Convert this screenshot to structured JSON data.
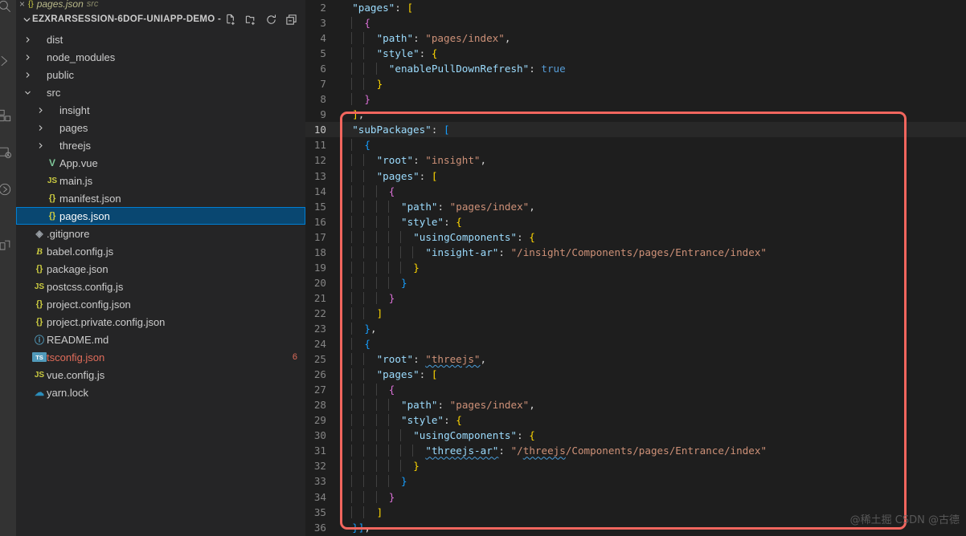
{
  "activity_bar": {
    "icons": [
      "search-icon",
      "source-control-icon",
      "extensions-icon",
      "debug-icon",
      "remote-icon",
      "testing-icon"
    ]
  },
  "tab": {
    "label": "pages.json",
    "sublabel": "src",
    "close": "×",
    "icon": "json-icon"
  },
  "sidebar": {
    "title": "EZXRARSESSION-6DOF-UNIAPP-DEMO - ...",
    "actions": [
      {
        "name": "new-file-icon",
        "tooltip": "New File"
      },
      {
        "name": "new-folder-icon",
        "tooltip": "New Folder"
      },
      {
        "name": "refresh-icon",
        "tooltip": "Refresh Explorer"
      },
      {
        "name": "collapse-all-icon",
        "tooltip": "Collapse Folders in Explorer"
      }
    ],
    "tree": [
      {
        "label": "dist",
        "type": "folder",
        "indent": 1,
        "expanded": false
      },
      {
        "label": "node_modules",
        "type": "folder",
        "indent": 1,
        "expanded": false
      },
      {
        "label": "public",
        "type": "folder",
        "indent": 1,
        "expanded": false
      },
      {
        "label": "src",
        "type": "folder",
        "indent": 1,
        "expanded": true
      },
      {
        "label": "insight",
        "type": "folder",
        "indent": 2,
        "expanded": false
      },
      {
        "label": "pages",
        "type": "folder",
        "indent": 2,
        "expanded": false
      },
      {
        "label": "threejs",
        "type": "folder",
        "indent": 2,
        "expanded": false
      },
      {
        "label": "App.vue",
        "type": "vue",
        "indent": 2,
        "icon_glyph": "V"
      },
      {
        "label": "main.js",
        "type": "js",
        "indent": 2,
        "icon_glyph": "JS"
      },
      {
        "label": "manifest.json",
        "type": "json",
        "indent": 2,
        "icon_glyph": "{}"
      },
      {
        "label": "pages.json",
        "type": "json",
        "indent": 2,
        "icon_glyph": "{}",
        "selected": true
      },
      {
        "label": ".gitignore",
        "type": "git",
        "indent": 1,
        "icon_glyph": "◈"
      },
      {
        "label": "babel.config.js",
        "type": "babel",
        "indent": 1,
        "icon_glyph": "B"
      },
      {
        "label": "package.json",
        "type": "json",
        "indent": 1,
        "icon_glyph": "{}"
      },
      {
        "label": "postcss.config.js",
        "type": "js",
        "indent": 1,
        "icon_glyph": "JS"
      },
      {
        "label": "project.config.json",
        "type": "json",
        "indent": 1,
        "icon_glyph": "{}"
      },
      {
        "label": "project.private.config.json",
        "type": "json",
        "indent": 1,
        "icon_glyph": "{}"
      },
      {
        "label": "README.md",
        "type": "md",
        "indent": 1,
        "icon_glyph": "ⓘ"
      },
      {
        "label": "tsconfig.json",
        "type": "ts",
        "indent": 1,
        "icon_glyph": "TS",
        "error": true,
        "badge": "6"
      },
      {
        "label": "vue.config.js",
        "type": "js",
        "indent": 1,
        "icon_glyph": "JS"
      },
      {
        "label": "yarn.lock",
        "type": "yarn",
        "indent": 1,
        "icon_glyph": "☁"
      }
    ]
  },
  "editor": {
    "language": "json",
    "first_visible_line": 2,
    "current_line": 10,
    "lines": [
      {
        "n": 2,
        "indent": 1,
        "tokens": [
          {
            "t": "\"pages\"",
            "c": "k"
          },
          {
            "t": ": ",
            "c": "p"
          },
          {
            "t": "[",
            "c": "b0"
          }
        ]
      },
      {
        "n": 3,
        "indent": 2,
        "tokens": [
          {
            "t": "{",
            "c": "b1"
          }
        ]
      },
      {
        "n": 4,
        "indent": 3,
        "tokens": [
          {
            "t": "\"path\"",
            "c": "k"
          },
          {
            "t": ": ",
            "c": "p"
          },
          {
            "t": "\"pages/index\"",
            "c": "s"
          },
          {
            "t": ",",
            "c": "p"
          }
        ]
      },
      {
        "n": 5,
        "indent": 3,
        "tokens": [
          {
            "t": "\"style\"",
            "c": "k"
          },
          {
            "t": ": ",
            "c": "p"
          },
          {
            "t": "{",
            "c": "b0"
          }
        ]
      },
      {
        "n": 6,
        "indent": 4,
        "tokens": [
          {
            "t": "\"enablePullDownRefresh\"",
            "c": "k"
          },
          {
            "t": ": ",
            "c": "p"
          },
          {
            "t": "true",
            "c": "bool"
          }
        ]
      },
      {
        "n": 7,
        "indent": 3,
        "tokens": [
          {
            "t": "}",
            "c": "b0"
          }
        ]
      },
      {
        "n": 8,
        "indent": 2,
        "tokens": [
          {
            "t": "}",
            "c": "b1"
          }
        ]
      },
      {
        "n": 9,
        "indent": 1,
        "tokens": [
          {
            "t": "]",
            "c": "b0"
          },
          {
            "t": ",",
            "c": "p"
          }
        ]
      },
      {
        "n": 10,
        "indent": 1,
        "tokens": [
          {
            "t": "\"subPackages\"",
            "c": "k"
          },
          {
            "t": ": ",
            "c": "p"
          },
          {
            "t": "[",
            "c": "b2"
          }
        ],
        "current": true
      },
      {
        "n": 11,
        "indent": 2,
        "tokens": [
          {
            "t": "{",
            "c": "b2"
          }
        ]
      },
      {
        "n": 12,
        "indent": 3,
        "tokens": [
          {
            "t": "\"root\"",
            "c": "k"
          },
          {
            "t": ": ",
            "c": "p"
          },
          {
            "t": "\"insight\"",
            "c": "s"
          },
          {
            "t": ",",
            "c": "p"
          }
        ]
      },
      {
        "n": 13,
        "indent": 3,
        "tokens": [
          {
            "t": "\"pages\"",
            "c": "k"
          },
          {
            "t": ": ",
            "c": "p"
          },
          {
            "t": "[",
            "c": "b0"
          }
        ]
      },
      {
        "n": 14,
        "indent": 4,
        "tokens": [
          {
            "t": "{",
            "c": "b1"
          }
        ]
      },
      {
        "n": 15,
        "indent": 5,
        "tokens": [
          {
            "t": "\"path\"",
            "c": "k"
          },
          {
            "t": ": ",
            "c": "p"
          },
          {
            "t": "\"pages/index\"",
            "c": "s"
          },
          {
            "t": ",",
            "c": "p"
          }
        ]
      },
      {
        "n": 16,
        "indent": 5,
        "tokens": [
          {
            "t": "\"style\"",
            "c": "k"
          },
          {
            "t": ": ",
            "c": "p"
          },
          {
            "t": "{",
            "c": "b0"
          }
        ]
      },
      {
        "n": 17,
        "indent": 6,
        "tokens": [
          {
            "t": "\"usingComponents\"",
            "c": "k"
          },
          {
            "t": ": ",
            "c": "p"
          },
          {
            "t": "{",
            "c": "b0"
          }
        ]
      },
      {
        "n": 18,
        "indent": 7,
        "tokens": [
          {
            "t": "\"insight-ar\"",
            "c": "k"
          },
          {
            "t": ": ",
            "c": "p"
          },
          {
            "t": "\"/insight/Components/pages/Entrance/index\"",
            "c": "s"
          }
        ]
      },
      {
        "n": 19,
        "indent": 6,
        "tokens": [
          {
            "t": "}",
            "c": "b0"
          }
        ]
      },
      {
        "n": 20,
        "indent": 5,
        "tokens": [
          {
            "t": "}",
            "c": "b2"
          }
        ]
      },
      {
        "n": 21,
        "indent": 4,
        "tokens": [
          {
            "t": "}",
            "c": "b1"
          }
        ]
      },
      {
        "n": 22,
        "indent": 3,
        "tokens": [
          {
            "t": "]",
            "c": "b0"
          }
        ]
      },
      {
        "n": 23,
        "indent": 2,
        "tokens": [
          {
            "t": "}",
            "c": "b2"
          },
          {
            "t": ",",
            "c": "p"
          }
        ]
      },
      {
        "n": 24,
        "indent": 2,
        "tokens": [
          {
            "t": "{",
            "c": "b2"
          }
        ]
      },
      {
        "n": 25,
        "indent": 3,
        "tokens": [
          {
            "t": "\"root\"",
            "c": "k"
          },
          {
            "t": ": ",
            "c": "p"
          },
          {
            "t": "\"threejs\"",
            "c": "s",
            "sq": true
          },
          {
            "t": ",",
            "c": "p"
          }
        ]
      },
      {
        "n": 26,
        "indent": 3,
        "tokens": [
          {
            "t": "\"pages\"",
            "c": "k"
          },
          {
            "t": ": ",
            "c": "p"
          },
          {
            "t": "[",
            "c": "b0"
          }
        ]
      },
      {
        "n": 27,
        "indent": 4,
        "tokens": [
          {
            "t": "{",
            "c": "b1"
          }
        ]
      },
      {
        "n": 28,
        "indent": 5,
        "tokens": [
          {
            "t": "\"path\"",
            "c": "k"
          },
          {
            "t": ": ",
            "c": "p"
          },
          {
            "t": "\"pages/index\"",
            "c": "s"
          },
          {
            "t": ",",
            "c": "p"
          }
        ]
      },
      {
        "n": 29,
        "indent": 5,
        "tokens": [
          {
            "t": "\"style\"",
            "c": "k"
          },
          {
            "t": ": ",
            "c": "p"
          },
          {
            "t": "{",
            "c": "b0"
          }
        ]
      },
      {
        "n": 30,
        "indent": 6,
        "tokens": [
          {
            "t": "\"usingComponents\"",
            "c": "k"
          },
          {
            "t": ": ",
            "c": "p"
          },
          {
            "t": "{",
            "c": "b0"
          }
        ]
      },
      {
        "n": 31,
        "indent": 7,
        "tokens": [
          {
            "t": "\"threejs-ar\"",
            "c": "k",
            "sq": true
          },
          {
            "t": ": ",
            "c": "p"
          },
          {
            "t": "\"/threejs/Components/pages/Entrance/index\"",
            "c": "s",
            "sq_prefix": true
          }
        ]
      },
      {
        "n": 32,
        "indent": 6,
        "tokens": [
          {
            "t": "}",
            "c": "b0"
          }
        ]
      },
      {
        "n": 33,
        "indent": 5,
        "tokens": [
          {
            "t": "}",
            "c": "b2"
          }
        ]
      },
      {
        "n": 34,
        "indent": 4,
        "tokens": [
          {
            "t": "}",
            "c": "b1"
          }
        ]
      },
      {
        "n": 35,
        "indent": 3,
        "tokens": [
          {
            "t": "]",
            "c": "b0"
          }
        ]
      },
      {
        "n": 36,
        "indent": 1,
        "tokens": [
          {
            "t": "}",
            "c": "b2"
          },
          {
            "t": "]",
            "c": "b2"
          },
          {
            "t": ",",
            "c": "p"
          }
        ]
      }
    ],
    "annotation": {
      "type": "red-rectangle",
      "color": "#f2665e",
      "covers_lines": "9-35"
    }
  },
  "watermark": {
    "text": "@稀土掘 CSDN @古德"
  },
  "colors": {
    "editor_bg": "#1e1e1e",
    "sidebar_bg": "#252526",
    "activitybar_bg": "#333333",
    "selection_blue": "#094771",
    "selection_border": "#007fd4",
    "annotation_red": "#f2665e",
    "error_red": "#e06c5a",
    "key_blue": "#9cdcfe",
    "string_orange": "#ce9178"
  }
}
